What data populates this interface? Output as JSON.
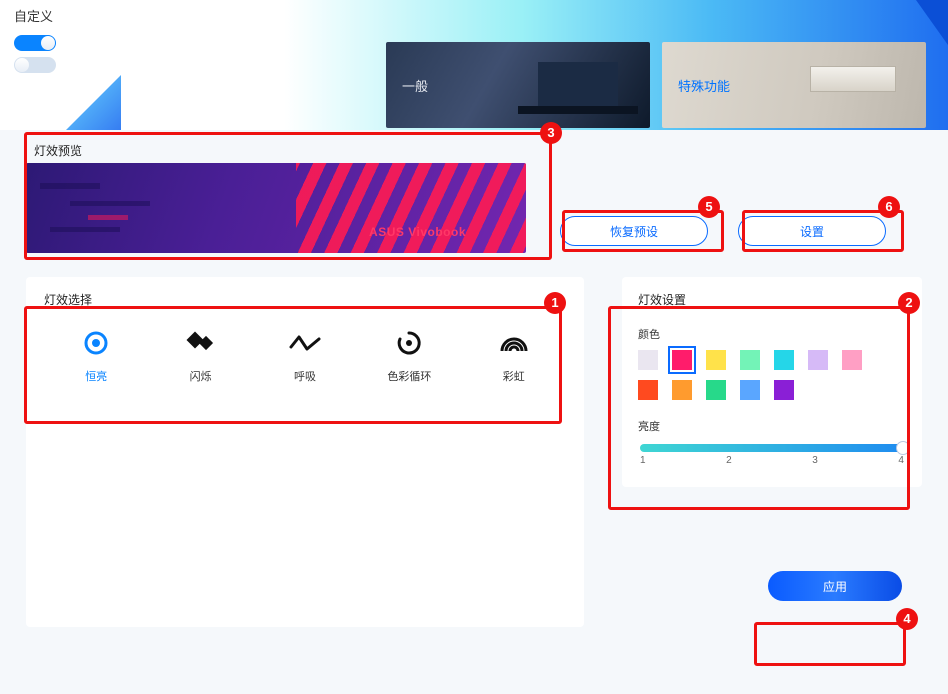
{
  "header": {
    "customize_label": "自定义",
    "tile_a_label": "一般",
    "tile_b_label": "特殊功能"
  },
  "preview": {
    "title": "灯效预览",
    "brand": "ASUS Vivobook"
  },
  "buttons": {
    "restore": "恢复预设",
    "settings": "设置",
    "apply": "应用"
  },
  "effects_panel": {
    "title": "灯效选择",
    "items": [
      {
        "label": "恒亮"
      },
      {
        "label": "闪烁"
      },
      {
        "label": "呼吸"
      },
      {
        "label": "色彩循环"
      },
      {
        "label": "彩虹"
      }
    ],
    "selected_index": 0
  },
  "settings_panel": {
    "title": "灯效设置",
    "color_label": "颜色",
    "colors": [
      "#eae6f0",
      "#ff1c6b",
      "#ffe24a",
      "#73f3b7",
      "#25d6e8",
      "#d6baf7",
      "#ff9fc4",
      "#ff4a1f",
      "#ff9b2e",
      "#27d98a",
      "#5aa6ff",
      "#8a1fd6"
    ],
    "selected_color_index": 1,
    "brightness_label": "亮度",
    "brightness_ticks": [
      "1",
      "2",
      "3",
      "4"
    ],
    "brightness_value": 4
  },
  "callouts": {
    "1": "1",
    "2": "2",
    "3": "3",
    "4": "4",
    "5": "5",
    "6": "6"
  }
}
